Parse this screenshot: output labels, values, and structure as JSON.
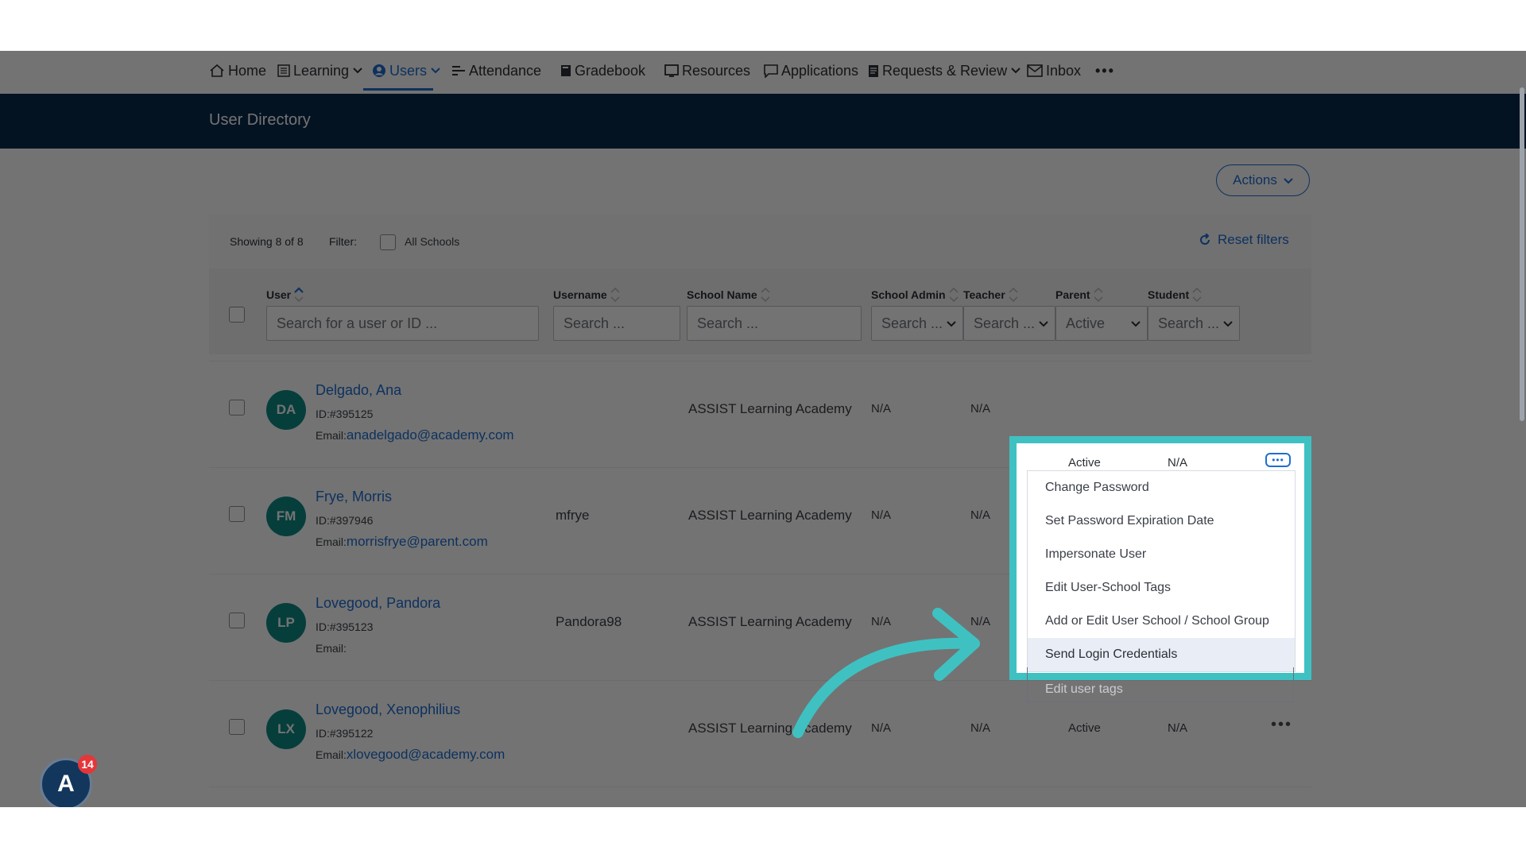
{
  "nav": {
    "items": [
      {
        "label": "Home",
        "icon": "home-icon"
      },
      {
        "label": "Learning",
        "icon": "grid-icon",
        "dropdown": true
      },
      {
        "label": "Users",
        "icon": "user-circle-icon",
        "dropdown": true,
        "active": true
      },
      {
        "label": "Attendance",
        "icon": "list-icon"
      },
      {
        "label": "Gradebook",
        "icon": "book-icon"
      },
      {
        "label": "Resources",
        "icon": "monitor-icon"
      },
      {
        "label": "Applications",
        "icon": "chat-icon"
      },
      {
        "label": "Requests & Review",
        "icon": "doc-icon",
        "dropdown": true
      },
      {
        "label": "Inbox",
        "icon": "mail-icon"
      }
    ],
    "more": "•••"
  },
  "header": {
    "title": "User Directory"
  },
  "actions": {
    "label": "Actions"
  },
  "toolbar": {
    "showing": "Showing 8 of 8",
    "filter_label": "Filter:",
    "all_schools": "All Schools",
    "reset_filters": "Reset filters"
  },
  "table": {
    "headers": {
      "user": "User",
      "username": "Username",
      "school_name": "School Name",
      "school_admin": "School Admin",
      "teacher": "Teacher",
      "parent": "Parent",
      "student": "Student"
    },
    "filters": {
      "user_placeholder": "Search for a user or ID ...",
      "username_placeholder": "Search ...",
      "school_placeholder": "Search ...",
      "school_admin": "Search ...",
      "teacher": "Search ...",
      "parent": "Active",
      "student": "Search ..."
    },
    "rows": [
      {
        "initials": "DA",
        "name": "Delgado, Ana",
        "id": "ID:#395125",
        "email_label": "Email:",
        "email": "anadelgado@academy.com",
        "username": "",
        "school": "ASSIST Learning Academy",
        "school_admin": "N/A",
        "teacher": "N/A",
        "parent": "Active",
        "student": "N/A"
      },
      {
        "initials": "FM",
        "name": "Frye, Morris",
        "id": "ID:#397946",
        "email_label": "Email:",
        "email": "morrisfrye@parent.com",
        "username": "mfrye",
        "school": "ASSIST Learning Academy",
        "school_admin": "N/A",
        "teacher": "N/A",
        "parent": "",
        "student": ""
      },
      {
        "initials": "LP",
        "name": "Lovegood, Pandora",
        "id": "ID:#395123",
        "email_label": "Email:",
        "email": "",
        "username": "Pandora98",
        "school": "ASSIST Learning Academy",
        "school_admin": "N/A",
        "teacher": "N/A",
        "parent": "",
        "student": ""
      },
      {
        "initials": "LX",
        "name": "Lovegood, Xenophilius",
        "id": "ID:#395122",
        "email_label": "Email:",
        "email": "xlovegood@academy.com",
        "username": "",
        "school": "ASSIST Learning Academy",
        "school_admin": "N/A",
        "teacher": "N/A",
        "parent": "Active",
        "student": "N/A"
      }
    ]
  },
  "row_menu": {
    "parent": "Active",
    "student": "N/A",
    "items": [
      "Change Password",
      "Set Password Expiration Date",
      "Impersonate User",
      "Edit User-School Tags",
      "Add or Edit User School / School Group",
      "Send Login Credentials"
    ],
    "selected": "Send Login Credentials",
    "overflow_item": "Edit user tags"
  },
  "badge": {
    "letter": "A",
    "count": "14"
  },
  "colors": {
    "accent": "#1e6ed2",
    "header_band": "#0b2a4d",
    "avatar": "#0f8a86",
    "highlight": "#3fc1c2",
    "badge": "#e5363a"
  }
}
